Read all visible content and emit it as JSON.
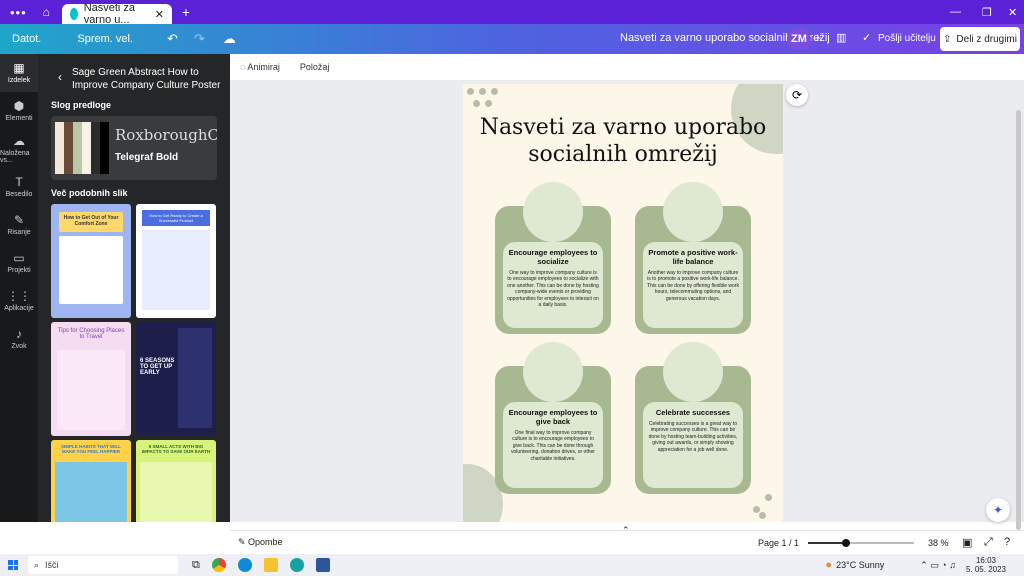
{
  "browser": {
    "tab_title": "Nasveti za varno u...",
    "new_tab": "+"
  },
  "toolbar": {
    "file": "Datot.",
    "resize": "Sprem. vel.",
    "doc_title": "Nasveti za varno uporabo socialnih omrežij",
    "avatar": "ZM",
    "send_teacher": "Pošlji učitelju",
    "share": "Deli z drugimi"
  },
  "rail": [
    {
      "label": "Izdelek",
      "icon": "▦"
    },
    {
      "label": "Elementi",
      "icon": "⬢"
    },
    {
      "label": "Naložena vs...",
      "icon": "☁"
    },
    {
      "label": "Besedilo",
      "icon": "T"
    },
    {
      "label": "Risanje",
      "icon": "✎"
    },
    {
      "label": "Projekti",
      "icon": "▭"
    },
    {
      "label": "Aplikacije",
      "icon": "⋮⋮"
    },
    {
      "label": "Zvok",
      "icon": "♪"
    }
  ],
  "panel": {
    "title": "Sage Green Abstract How to Improve Company Culture Poster",
    "style_heading": "Slog predloge",
    "font_main": "RoxboroughC",
    "font_sub": "Telegraf Bold",
    "similar_heading": "Več podobnih slik",
    "thumbs": [
      "How to Get Out of Your Comfort Zone",
      "How to Get Ready to Create a Successful Product",
      "Tips for Choosing Places to Travel",
      "6 SEASONS TO GET UP EARLY",
      "SIMPLE HABITS THAT WILL MAKE YOU FEEL HAPPIER",
      "5 SMALL ACTS WITH BIG IMPACTS TO SAVE OUR EARTH"
    ]
  },
  "canvas_toolbar": {
    "animate": "Animiraj",
    "position": "Položaj"
  },
  "poster": {
    "title": "Nasveti za varno uporabo socialnih omrežij",
    "cards": [
      {
        "heading": "Encourage employees to socialize",
        "body": "One way to improve company culture is to encourage employees to socialize with one another. This can be done by hosting company-wide events or providing opportunities for employees to interact on a daily basis."
      },
      {
        "heading": "Promote a positive work-life balance",
        "body": "Another way to improve company culture is to promote a positive work-life balance. This can be done by offering flexible work hours, telecommuting options, and generous vacation days."
      },
      {
        "heading": "Encourage employees to give back",
        "body": "One final way to improve company culture is to encourage employees to give back. This can be done through volunteering, donation drives, or other charitable initiatives."
      },
      {
        "heading": "Celebrate successes",
        "body": "Celebrating successes is a great way to improve company culture. This can be done by hosting team-building activities, giving out awards, or simply showing appreciation for a job well done."
      }
    ]
  },
  "status": {
    "notes": "Opombe",
    "page": "Page 1 / 1",
    "zoom": "38 %",
    "zoom_value": 0.38
  },
  "taskbar": {
    "search": "Išči",
    "weather": "23°C Sunny",
    "time": "16:03",
    "date": "5. 05. 2023"
  }
}
